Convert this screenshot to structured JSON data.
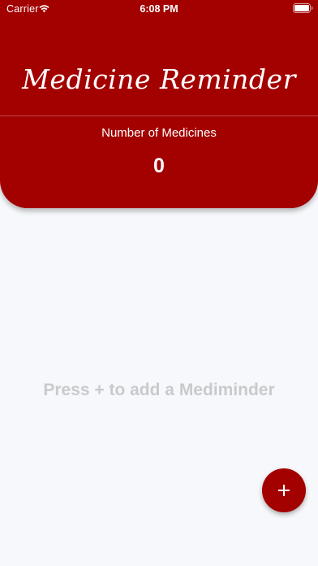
{
  "status_bar": {
    "carrier": "Carrier",
    "time": "6:08 PM",
    "wifi_icon": "wifi-icon",
    "battery_icon": "battery-icon"
  },
  "header": {
    "title": "Medicine Reminder",
    "count_label": "Number of Medicines",
    "count_value": "0",
    "background_color": "#a30000"
  },
  "main": {
    "empty_hint": "Press + to add a Mediminder"
  },
  "fab": {
    "icon": "plus-icon",
    "color": "#a30000"
  }
}
